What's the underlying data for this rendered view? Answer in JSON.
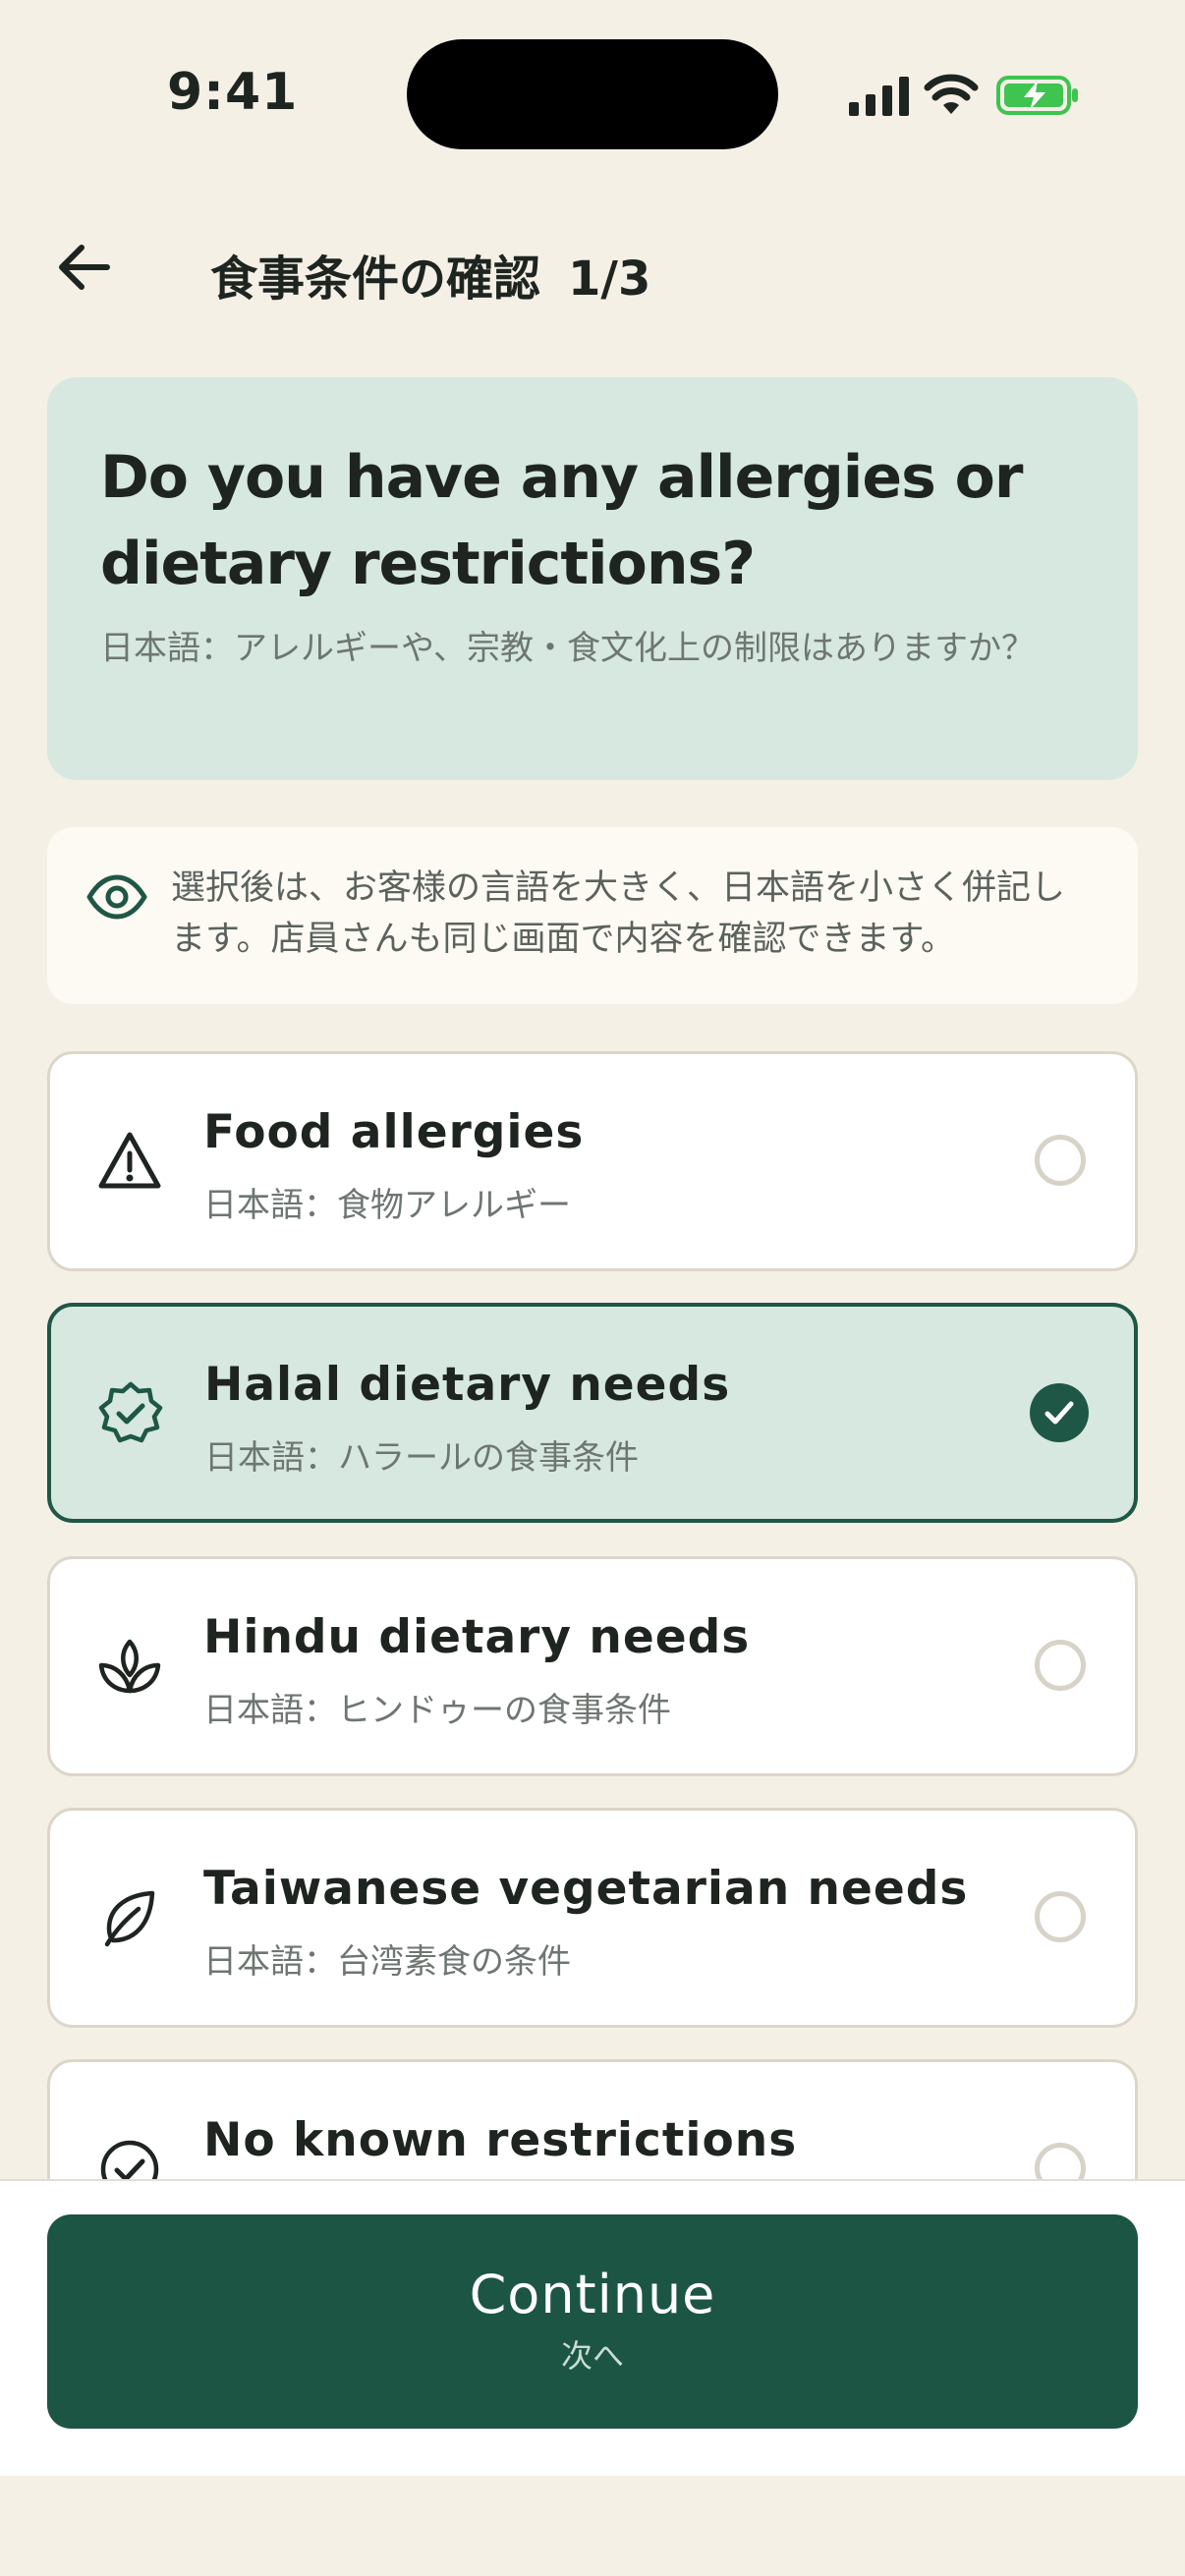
{
  "status_bar": {
    "time": "9:41"
  },
  "header": {
    "title": "食事条件の確認",
    "step": "1/3"
  },
  "hero": {
    "question": "Do you have any allergies or dietary restrictions?",
    "question_ja": "日本語：アレルギーや、宗教・食文化上の制限はありますか？"
  },
  "note": {
    "text": "選択後は、お客様の言語を大きく、日本語を小さく併記します。店員さんも同じ画面で内容を確認できます。"
  },
  "options": [
    {
      "label": "Food allergies",
      "label_ja": "日本語：食物アレルギー",
      "icon": "warning-triangle-icon",
      "selected": false
    },
    {
      "label": "Halal dietary needs",
      "label_ja": "日本語：ハラールの食事条件",
      "icon": "verified-badge-icon",
      "selected": true
    },
    {
      "label": "Hindu dietary needs",
      "label_ja": "日本語：ヒンドゥーの食事条件",
      "icon": "lotus-icon",
      "selected": false
    },
    {
      "label": "Taiwanese vegetarian needs",
      "label_ja": "日本語：台湾素食の条件",
      "icon": "leaf-icon",
      "selected": false
    },
    {
      "label": "No known restrictions",
      "label_ja": "",
      "icon": "check-circle-icon",
      "selected": false
    }
  ],
  "continue_button": {
    "label": "Continue",
    "label_ja": "次へ"
  },
  "colors": {
    "accent": "#1C5544",
    "hero_bg": "#D6E8DF",
    "page_bg": "#F4F0E6",
    "battery_green": "#3FC44F"
  }
}
